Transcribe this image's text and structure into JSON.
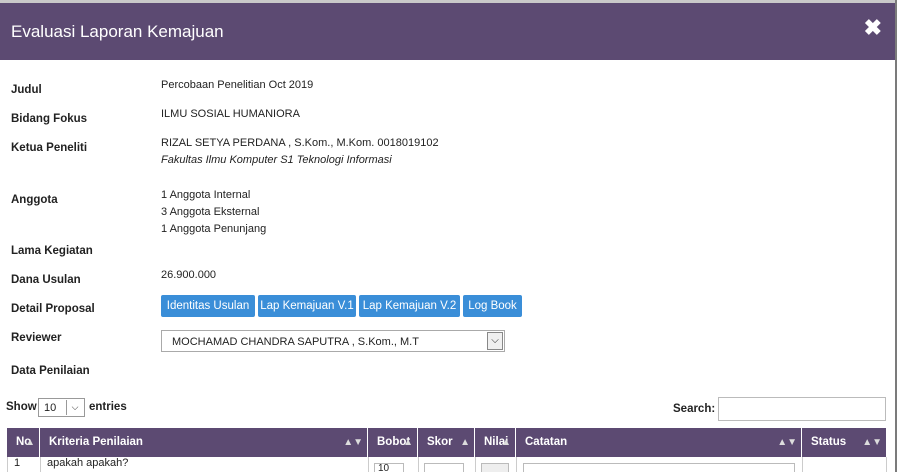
{
  "modal": {
    "title": "Evaluasi Laporan Kemajuan",
    "close_glyph": "✖"
  },
  "fields": {
    "judul": {
      "label": "Judul",
      "value": "Percobaan Penelitian Oct 2019"
    },
    "bidang_fokus": {
      "label": "Bidang Fokus",
      "value": "ILMU SOSIAL HUMANIORA"
    },
    "ketua_peneliti": {
      "label": "Ketua Peneliti",
      "name": "RIZAL SETYA PERDANA , S.Kom., M.Kom. 0018019102",
      "affiliation": "Fakultas Ilmu Komputer S1 Teknologi Informasi"
    },
    "anggota": {
      "label": "Anggota",
      "lines": [
        "1 Anggota Internal",
        "3 Anggota Eksternal",
        "1 Anggota Penunjang"
      ]
    },
    "lama_kegiatan": {
      "label": "Lama Kegiatan",
      "value": ""
    },
    "dana_usulan": {
      "label": "Dana Usulan",
      "value": "26.900.000"
    },
    "detail_proposal": {
      "label": "Detail Proposal",
      "buttons": [
        "Identitas Usulan",
        "Lap Kemajuan V.1",
        "Lap Kemajuan V.2",
        "Log Book"
      ]
    },
    "reviewer": {
      "label": "Reviewer",
      "selected": "MOCHAMAD CHANDRA SAPUTRA , S.Kom., M.T"
    },
    "data_penilaian": {
      "label": "Data Penilaian"
    }
  },
  "table_controls": {
    "show_label": "Show",
    "length_value": "10",
    "entries_label": "entries",
    "search_label": "Search:",
    "search_value": ""
  },
  "table": {
    "columns": [
      "No",
      "Kriteria Penilaian",
      "Bobot",
      "Skor",
      "Nilai",
      "Catatan",
      "Status"
    ],
    "rows": [
      {
        "no": "1",
        "kriteria": "apakah apakah?",
        "bobot": "10"
      }
    ]
  },
  "colors": {
    "header_bg": "#5c4a72",
    "button_bg": "#3a8ed8"
  },
  "icons": {
    "close": "close-icon",
    "sort": "sort-icon",
    "dropdown": "chevron-down-icon"
  }
}
